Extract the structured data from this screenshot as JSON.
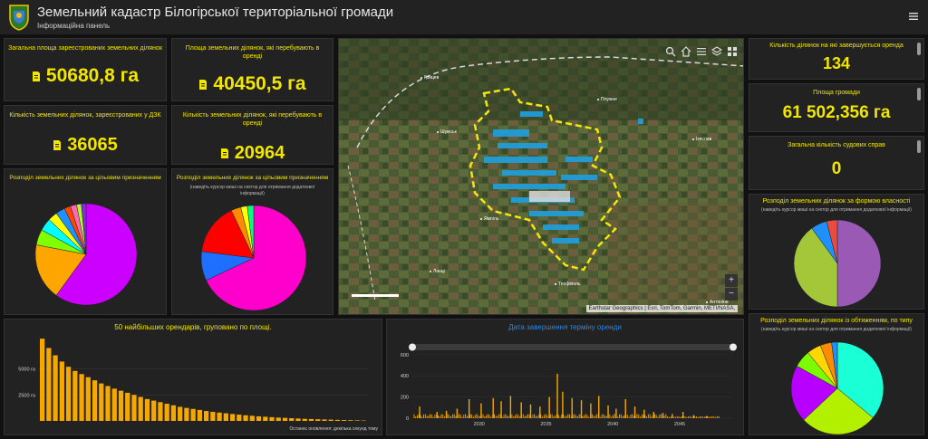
{
  "header": {
    "title": "Земельний кадастр Білогірської територіальної громади",
    "subtitle": "Інформаційна панель"
  },
  "kpis": {
    "total_area": {
      "title": "Загальна площа зареєстрованих земельних ділянок",
      "value": "50680,8 га"
    },
    "rented_area": {
      "title": "Площа земельних ділянок, які перебувають в оренді",
      "value": "40450,5 га"
    },
    "registered_count": {
      "title": "Кількість земельних ділянок, зареєстрованих у ДЗК",
      "value": "36065"
    },
    "rented_count": {
      "title": "Кількість земельних ділянок, які перебувають в оренді",
      "value": "20964"
    }
  },
  "pies_left": {
    "purpose_area": {
      "title": "Розподіл земельних ділянок за цільовим призначенням",
      "note": ""
    },
    "purpose_count": {
      "title": "Розподіл земельних ділянок за цільовим призначенням",
      "note": "(наведіть курсор миші на сектор для отримання додаткової інформації)"
    }
  },
  "right": {
    "lease_ending": {
      "title": "Кількість ділянок на які завершується оренда",
      "value": "134"
    },
    "community_area": {
      "title": "Площа громади",
      "value": "61 502,356 га"
    },
    "court_cases": {
      "title": "Загальна кількість судових справ",
      "value": "0"
    },
    "ownership_pie": {
      "title": "Розподіл земельних ділянок за формою власності",
      "note": "(наведіть курсор миші на сектор для отримання додаткової інформації)"
    },
    "encumbrance_pie": {
      "title": "Розподіл земельних ділянок із обтяженням, по типу",
      "note": "(наведіть курсор миші на сектор для отримання додаткової інформації)"
    }
  },
  "map": {
    "attribution": "Earthstar Geographics | Esri, TomTom, Garmin, METI/NASA,",
    "towns": [
      "Шумськ",
      "Ямпіль",
      "Теофіполь",
      "Ланці",
      "Грицев",
      "Ізяслав",
      "Плужне",
      "Антоніни"
    ],
    "zoom_in": "+",
    "zoom_out": "−"
  },
  "footer_note": "Останнє оновлення: декілька секунд тому",
  "colors": {
    "accent": "#f2e600",
    "bar": "#f5a800",
    "panel": "#222222",
    "map_boundary": "#f5e50a",
    "parcels": "#1ea0e0"
  },
  "chart_data": [
    {
      "type": "bar",
      "title": "50 найбільших орендарів, групованo по площі.",
      "ytick_labels": [
        "5000 га",
        "2500 га"
      ],
      "yticks": [
        5000,
        2500
      ],
      "ylim": [
        0,
        8000
      ],
      "values": [
        7900,
        7000,
        6300,
        5700,
        5200,
        4800,
        4500,
        4200,
        3900,
        3600,
        3350,
        3100,
        2900,
        2700,
        2500,
        2300,
        2100,
        1950,
        1800,
        1650,
        1500,
        1350,
        1250,
        1150,
        1050,
        950,
        870,
        800,
        730,
        660,
        600,
        540,
        490,
        440,
        400,
        360,
        320,
        290,
        260,
        230,
        200,
        180,
        160,
        140,
        120,
        100,
        85,
        70,
        55,
        40
      ]
    },
    {
      "type": "bar",
      "title": "Дата завершення терміну оренди",
      "xticks": [
        2030,
        2035,
        2040,
        2045
      ],
      "xlim": [
        2025,
        2049
      ],
      "yticks": [
        0,
        200,
        400,
        600
      ],
      "ylim": [
        0,
        650
      ],
      "spikes": [
        [
          2025.5,
          110
        ],
        [
          2026.8,
          60
        ],
        [
          2027.5,
          70
        ],
        [
          2028.3,
          90
        ],
        [
          2029.2,
          180
        ],
        [
          2030.1,
          140
        ],
        [
          2031.0,
          190
        ],
        [
          2031.6,
          160
        ],
        [
          2032.3,
          210
        ],
        [
          2033.1,
          150
        ],
        [
          2033.8,
          130
        ],
        [
          2034.5,
          110
        ],
        [
          2035.2,
          200
        ],
        [
          2035.8,
          420
        ],
        [
          2036.2,
          250
        ],
        [
          2036.9,
          190
        ],
        [
          2037.6,
          170
        ],
        [
          2038.3,
          140
        ],
        [
          2038.9,
          210
        ],
        [
          2039.6,
          120
        ],
        [
          2040.2,
          90
        ],
        [
          2040.9,
          180
        ],
        [
          2041.6,
          110
        ],
        [
          2042.3,
          80
        ],
        [
          2043.0,
          60
        ],
        [
          2043.7,
          50
        ],
        [
          2044.4,
          40
        ],
        [
          2045.2,
          60
        ],
        [
          2046.0,
          30
        ],
        [
          2047.0,
          20
        ]
      ]
    },
    {
      "type": "pie",
      "title": "Розподіл земельних ділянок за цільовим призначенням",
      "values": [
        60,
        18,
        5,
        4,
        3,
        3,
        2,
        2,
        1.5,
        1.5
      ],
      "colors": [
        "#cc00ff",
        "#ffa500",
        "#7fff00",
        "#00ffff",
        "#ffff00",
        "#1e90ff",
        "#ff4500",
        "#ff69b4",
        "#adff2f",
        "#8a2be2"
      ]
    },
    {
      "type": "pie",
      "title": "Розподіл земельних ділянок за цільовим призначенням",
      "values": [
        68,
        9,
        16,
        3,
        2,
        2
      ],
      "colors": [
        "#ff00cc",
        "#1e6fff",
        "#ff0000",
        "#ff8c00",
        "#ffff00",
        "#00ff7f"
      ]
    },
    {
      "type": "pie",
      "title": "Розподіл земельних ділянок за формою власності",
      "values": [
        50,
        40,
        6,
        4
      ],
      "colors": [
        "#9b59b6",
        "#a4c639",
        "#1e90ff",
        "#e74c3c"
      ]
    },
    {
      "type": "pie",
      "title": "Розподіл земельних ділянок із обтяженням, по типу",
      "values": [
        36,
        27,
        20,
        6,
        5,
        4,
        2
      ],
      "colors": [
        "#1affd5",
        "#b2f000",
        "#b700ff",
        "#7cfc00",
        "#ffd700",
        "#ff8c00",
        "#1e90ff"
      ]
    }
  ]
}
